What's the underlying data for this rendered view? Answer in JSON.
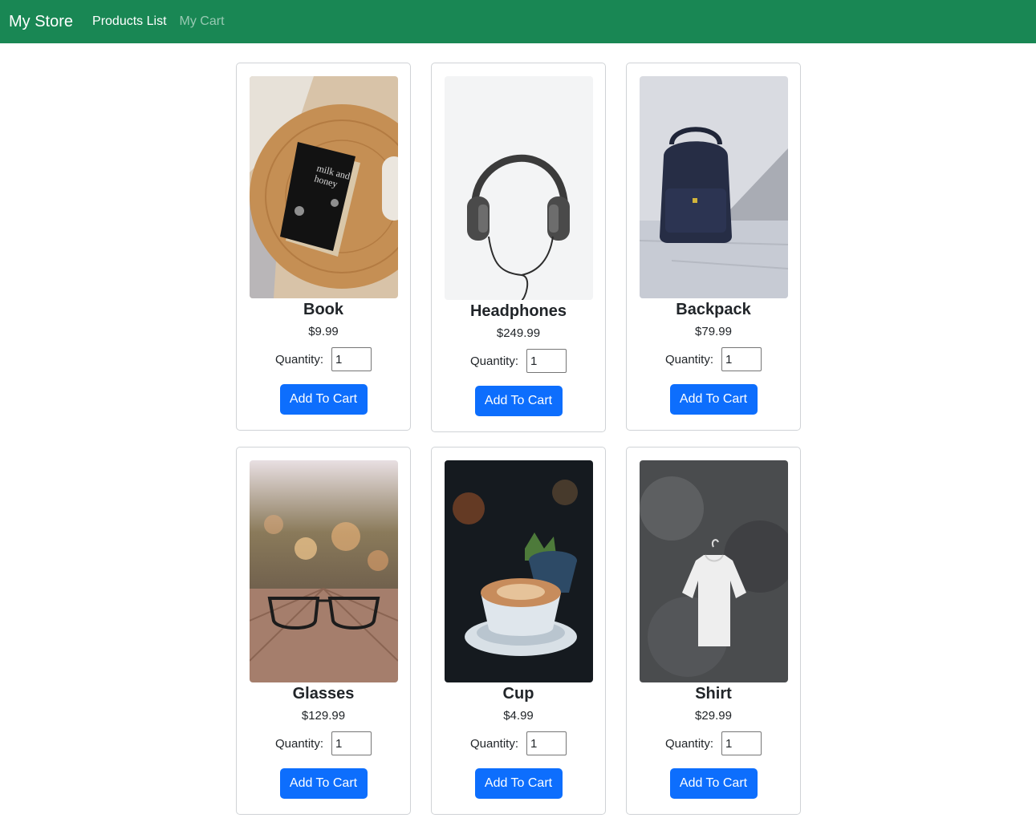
{
  "nav": {
    "brand": "My Store",
    "links": [
      "Products List",
      "My Cart"
    ]
  },
  "quantity_label": "Quantity:",
  "button_label": "Add To Cart",
  "products": [
    {
      "name": "Book",
      "price": "$9.99",
      "qty": "1"
    },
    {
      "name": "Headphones",
      "price": "$249.99",
      "qty": "1"
    },
    {
      "name": "Backpack",
      "price": "$79.99",
      "qty": "1"
    },
    {
      "name": "Glasses",
      "price": "$129.99",
      "qty": "1"
    },
    {
      "name": "Cup",
      "price": "$4.99",
      "qty": "1"
    },
    {
      "name": "Shirt",
      "price": "$29.99",
      "qty": "1"
    }
  ],
  "colors": {
    "navbar": "#198754",
    "button": "#0d6efd"
  }
}
